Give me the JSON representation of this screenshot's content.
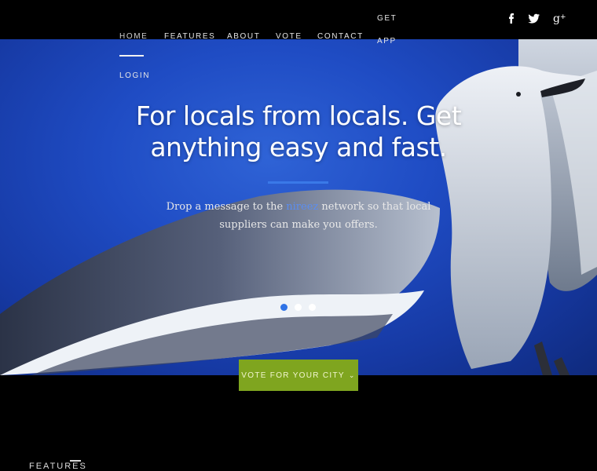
{
  "nav": {
    "items": [
      {
        "id": "home",
        "label": "HOME",
        "active": true
      },
      {
        "id": "features",
        "label": "FEATURES"
      },
      {
        "id": "about",
        "label": "ABOUT"
      },
      {
        "id": "vote",
        "label": "VOTE"
      },
      {
        "id": "contact",
        "label": "CONTACT"
      },
      {
        "id": "login",
        "label": "LOGIN"
      }
    ],
    "get_app": {
      "line1": "GET",
      "line2": "APP"
    }
  },
  "social": {
    "facebook": "f",
    "twitter": "twitter-icon",
    "googleplus": "g+"
  },
  "hero": {
    "title_line1": "For locals from locals. Get",
    "title_line2": "anything easy and fast.",
    "subtitle_before": "Drop a message to the ",
    "subtitle_brand": "nireez",
    "subtitle_after": " network so that local suppliers can make you offers.",
    "slides": 3,
    "active_slide": 0
  },
  "cta": {
    "label": "VOTE FOR YOUR CITY"
  },
  "features": {
    "heading": "FEATURES"
  },
  "colors": {
    "accent_blue": "#2f73e6",
    "logo_orange": "#e8641e",
    "logo_navy": "#16357f",
    "cta_green": "#7fa51f"
  }
}
